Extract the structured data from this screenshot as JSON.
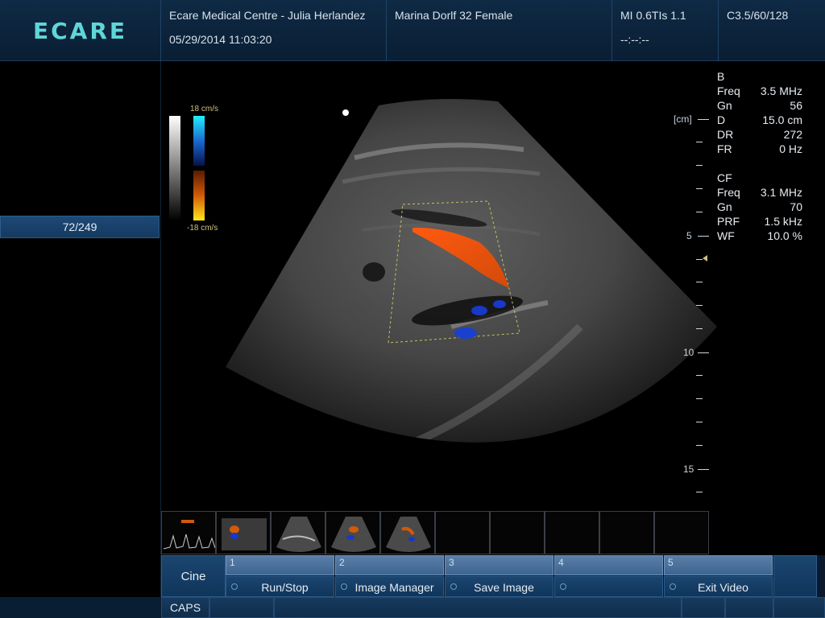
{
  "header": {
    "logo": "ECARE",
    "facility": "Ecare Medical Centre - Julia Herlandez",
    "datetime": "05/29/2014 11:03:20",
    "patient": "Marina Dorlf 32 Female",
    "mi_tis": "MI 0.6TIs 1.1",
    "time_placeholder": "--:--:--",
    "probe": "C3.5/60/128"
  },
  "left_panel": {
    "frame_counter": "72/249"
  },
  "color_scale": {
    "top_label": "18 cm/s",
    "bottom_label": "-18 cm/s"
  },
  "depth_scale": {
    "unit_label": "[cm]",
    "labels": [
      "5",
      "10",
      "15"
    ]
  },
  "params": {
    "b": {
      "title": "B",
      "rows": [
        {
          "k": "Freq",
          "v": "3.5 MHz"
        },
        {
          "k": "Gn",
          "v": "56"
        },
        {
          "k": "D",
          "v": "15.0 cm"
        },
        {
          "k": "DR",
          "v": "272"
        },
        {
          "k": "FR",
          "v": "0 Hz"
        }
      ]
    },
    "cf": {
      "title": "CF",
      "rows": [
        {
          "k": "Freq",
          "v": "3.1 MHz"
        },
        {
          "k": "Gn",
          "v": "70"
        },
        {
          "k": "PRF",
          "v": "1.5 kHz"
        },
        {
          "k": "WF",
          "v": "10.0 %"
        }
      ]
    }
  },
  "controls": {
    "cine": "Cine",
    "softkeys": [
      {
        "num": "1",
        "label": "Run/Stop"
      },
      {
        "num": "2",
        "label": "Image Manager"
      },
      {
        "num": "3",
        "label": "Save Image"
      },
      {
        "num": "4",
        "label": ""
      },
      {
        "num": "5",
        "label": "Exit Video"
      }
    ]
  },
  "status": {
    "caps": "CAPS"
  },
  "colors": {
    "header_bg": "#0f2a45",
    "accent": "#5fd6d8",
    "button_blue": "#1b4570"
  }
}
